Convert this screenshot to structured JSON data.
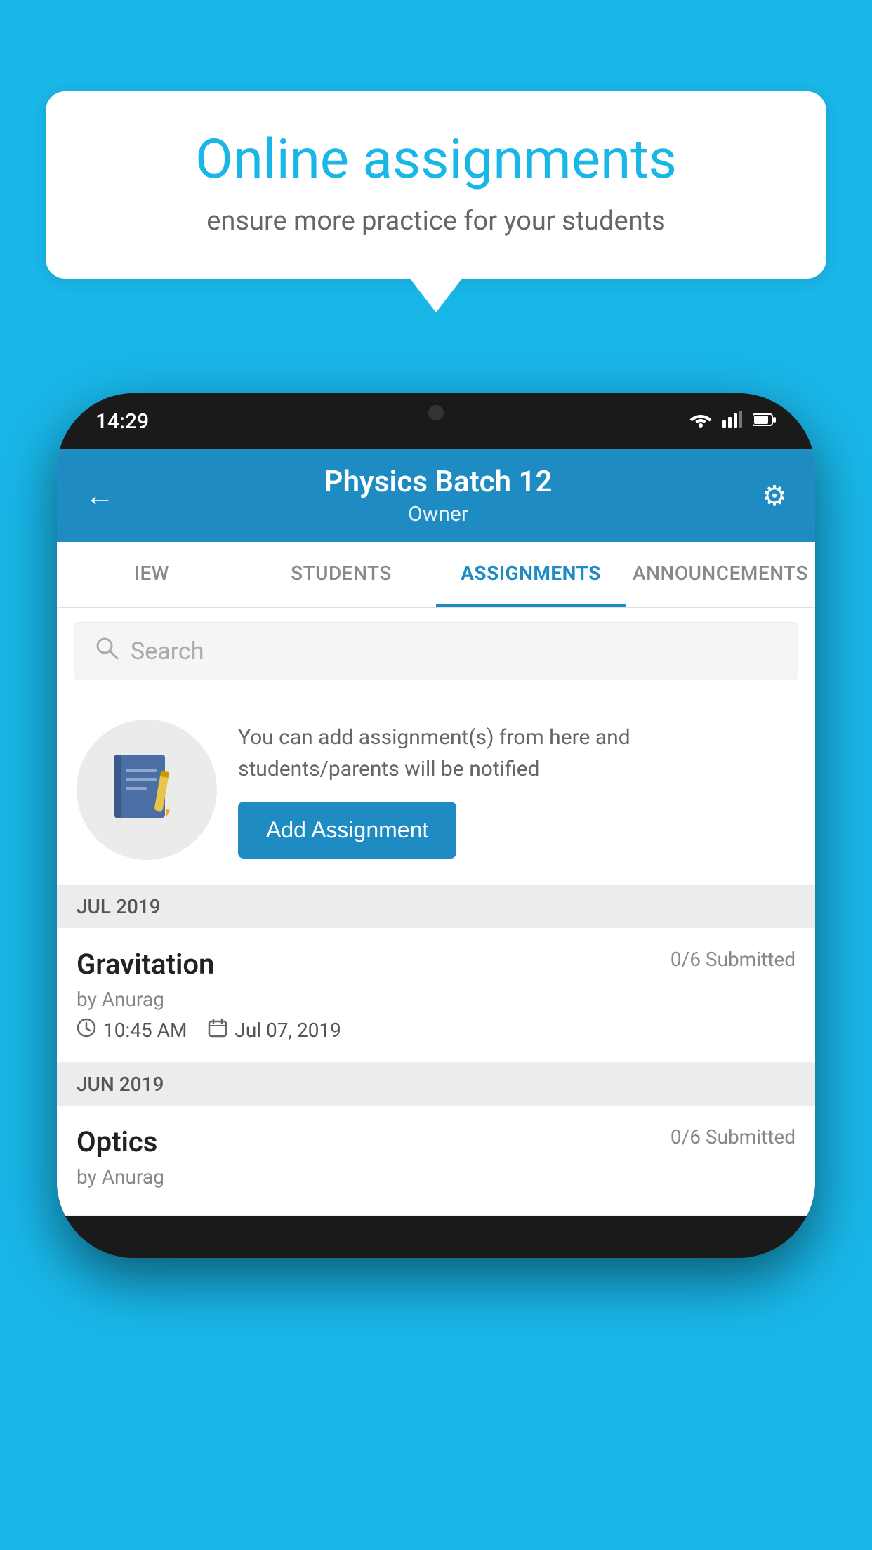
{
  "background": {
    "color": "#19b6e8"
  },
  "speech_bubble": {
    "title": "Online assignments",
    "subtitle": "ensure more practice for your students"
  },
  "status_bar": {
    "time": "14:29",
    "icons": [
      "wifi",
      "signal",
      "battery"
    ]
  },
  "app_header": {
    "title": "Physics Batch 12",
    "subtitle": "Owner",
    "back_label": "←",
    "gear_label": "⚙"
  },
  "tabs": [
    {
      "label": "IEW",
      "active": false
    },
    {
      "label": "STUDENTS",
      "active": false
    },
    {
      "label": "ASSIGNMENTS",
      "active": true
    },
    {
      "label": "ANNOUNCEMENTS",
      "active": false
    }
  ],
  "search": {
    "placeholder": "Search"
  },
  "empty_state": {
    "description": "You can add assignment(s) from here and students/parents will be notified",
    "button_label": "Add Assignment"
  },
  "sections": [
    {
      "month": "JUL 2019",
      "assignments": [
        {
          "title": "Gravitation",
          "submitted": "0/6 Submitted",
          "author": "by Anurag",
          "time": "10:45 AM",
          "date": "Jul 07, 2019"
        }
      ]
    },
    {
      "month": "JUN 2019",
      "assignments": [
        {
          "title": "Optics",
          "submitted": "0/6 Submitted",
          "author": "by Anurag",
          "time": "",
          "date": ""
        }
      ]
    }
  ]
}
